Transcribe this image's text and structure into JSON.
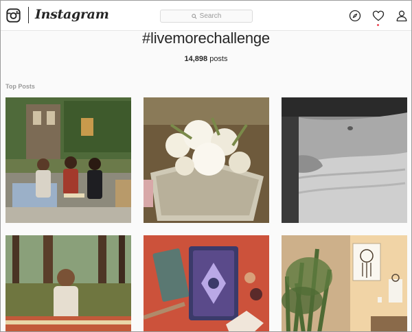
{
  "app": {
    "wordmark": "Instagram",
    "logo_icon": "instagram-camera-icon"
  },
  "search": {
    "placeholder": "Search",
    "icon": "search-icon"
  },
  "nav": {
    "explore_icon": "compass-icon",
    "activity_icon": "heart-icon",
    "profile_icon": "user-icon",
    "notification_color": "#ed4956"
  },
  "hashtag": {
    "title": "#livemorechallenge",
    "post_count": "14,898",
    "post_suffix": " posts"
  },
  "section": {
    "top_posts_label": "Top Posts"
  },
  "posts": [
    {
      "name": "post-three-women-sitting"
    },
    {
      "name": "post-white-flowers-tray"
    },
    {
      "name": "post-belly-black-white"
    },
    {
      "name": "post-woman-in-forest"
    },
    {
      "name": "post-tarot-cards-crystals"
    },
    {
      "name": "post-plant-dreamcatcher-room"
    }
  ],
  "colors": {
    "text": "#262626",
    "muted": "#999999",
    "border": "#dbdbdb"
  }
}
